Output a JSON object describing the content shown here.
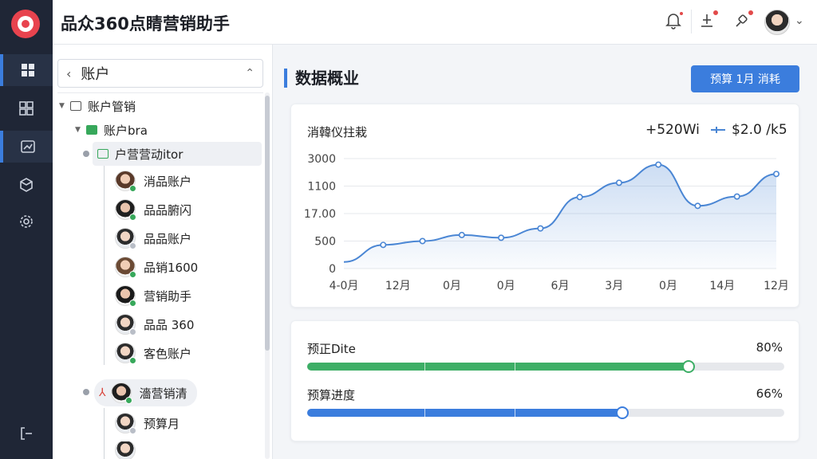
{
  "app": {
    "title": "品众360点睛营销助手"
  },
  "header": {
    "icons": [
      "bell-icon",
      "notification-icon",
      "message-icon"
    ]
  },
  "sidebar_rail": {
    "items": [
      "dashboard-icon",
      "grid-icon",
      "report-icon",
      "box-icon",
      "settings-icon",
      "logout-icon"
    ]
  },
  "tree": {
    "selector_label": "账户",
    "nodes": [
      {
        "label": "账户管销"
      },
      {
        "label": "账户bra"
      },
      {
        "label": "户营营动itor"
      }
    ],
    "users": [
      {
        "label": "消品账户",
        "status": "#37a85b"
      },
      {
        "label": "品品腑闪",
        "status": "#37a85b"
      },
      {
        "label": "品品账户",
        "status": "#b9bec7"
      },
      {
        "label": "品销1600",
        "status": "#37a85b"
      },
      {
        "label": "营销助手",
        "status": "#37a85b"
      },
      {
        "label": "品品 360",
        "status": "#b9bec7"
      },
      {
        "label": "客色账户",
        "status": "#37a85b"
      },
      {
        "label": "濇营销清",
        "status": "#37a85b"
      },
      {
        "label": "预算月",
        "status": "#b9bec7"
      }
    ]
  },
  "main": {
    "section_title": "数据概业",
    "budget_button": "预算  1月 消耗"
  },
  "chart_card": {
    "title": "消韓仪拄栽",
    "stat": "+520Wi",
    "legend": "$2.0 /k5"
  },
  "chart_data": {
    "type": "area",
    "title": "消韓仪拄栽",
    "y_tick_labels": [
      "3000",
      "1100",
      "17.00",
      "500",
      "0"
    ],
    "x_tick_labels": [
      "4-0月",
      "12月",
      "0月",
      "0月",
      "6月",
      "3月",
      "0月",
      "14月",
      "12月"
    ],
    "series": [
      {
        "values": [
          120,
          430,
          500,
          610,
          560,
          730,
          1300,
          1560,
          1890,
          1140,
          1310,
          1720
        ]
      }
    ],
    "ylim": [
      0,
      2000
    ],
    "grid": true,
    "color": "#4a86d4"
  },
  "progress": [
    {
      "label": "预正Dite",
      "value": 0.8,
      "value_text": "80%",
      "color": "#3dae66"
    },
    {
      "label": "预算进度",
      "value": 0.66,
      "value_text": "66%",
      "color": "#3b7ddd"
    }
  ]
}
